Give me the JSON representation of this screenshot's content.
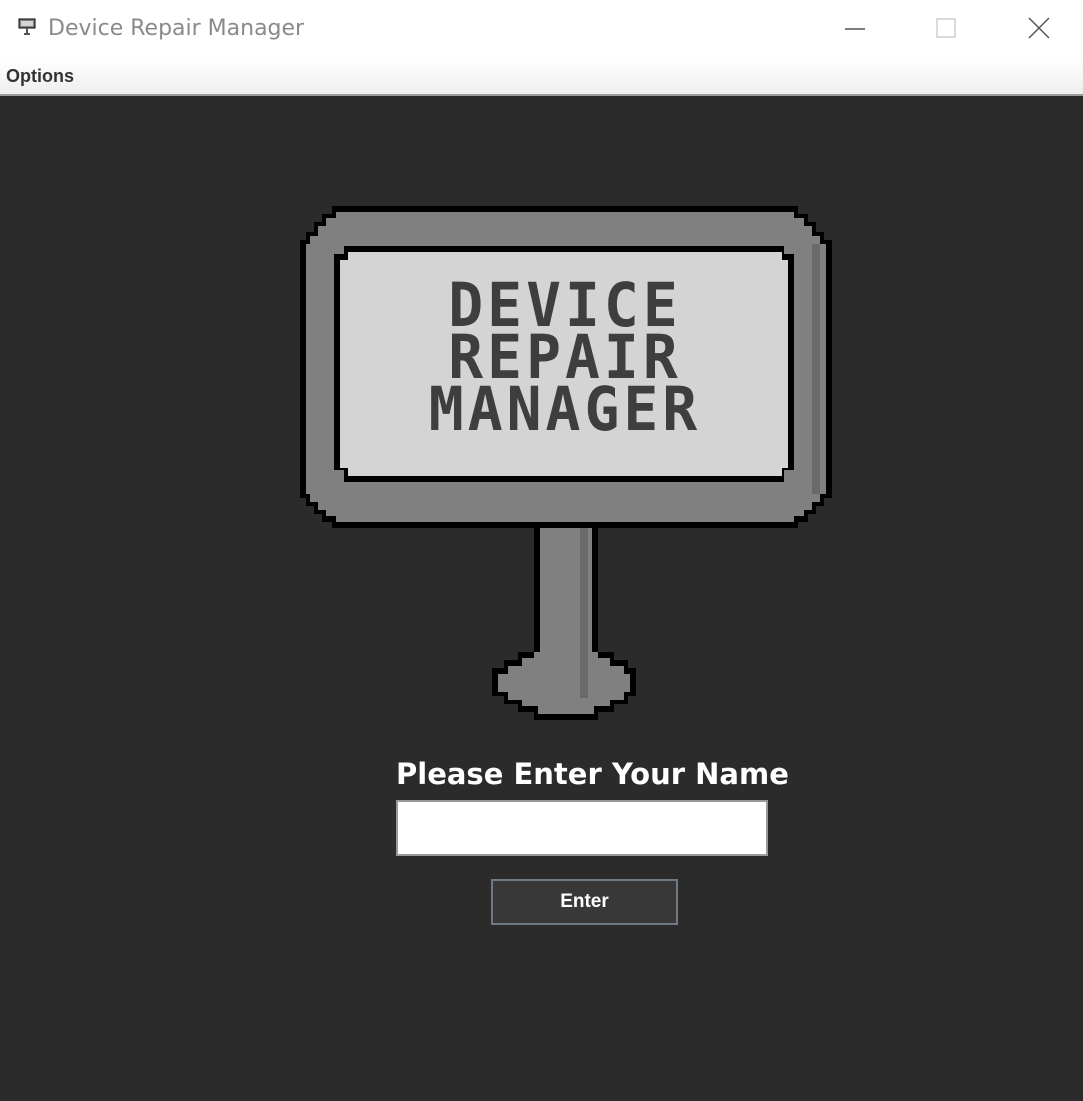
{
  "window": {
    "title": "Device Repair Manager",
    "app_icon": "sign-icon",
    "controls": {
      "minimize_icon": "minimize-icon",
      "maximize_icon": "maximize-icon",
      "close_icon": "close-icon"
    }
  },
  "menubar": {
    "items": [
      {
        "label": "Options"
      }
    ]
  },
  "logo": {
    "lines": [
      "DEVICE",
      "REPAIR",
      "MANAGER"
    ]
  },
  "form": {
    "prompt": "Please Enter Your Name",
    "name_value": "",
    "name_placeholder": "",
    "submit_label": "Enter"
  },
  "colors": {
    "background": "#2b2b2b",
    "sign_frame": "#808080",
    "sign_panel": "#d4d4d4",
    "sign_text": "#3e3e3e",
    "button_bg": "#383838",
    "button_border": "#6f7a85"
  }
}
